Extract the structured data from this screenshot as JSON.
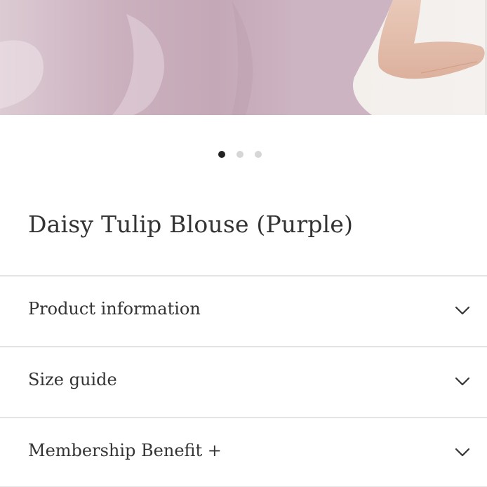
{
  "carousel": {
    "dot_count": 3,
    "active_index": 0
  },
  "product": {
    "title": "Daisy Tulip Blouse (Purple)"
  },
  "accordion": {
    "items": [
      {
        "label": "Product information",
        "icon": "chevron-down-icon",
        "expanded": false
      },
      {
        "label": "Size guide",
        "icon": "chevron-down-icon",
        "expanded": false
      },
      {
        "label": "Membership Benefit +",
        "icon": "chevron-down-icon",
        "expanded": false
      }
    ]
  },
  "colors": {
    "text": "#333333",
    "divider": "#e4e4e4",
    "dot_active": "#222222",
    "dot_inactive": "#d6d6d6",
    "blouse": "#cdb3c0"
  }
}
